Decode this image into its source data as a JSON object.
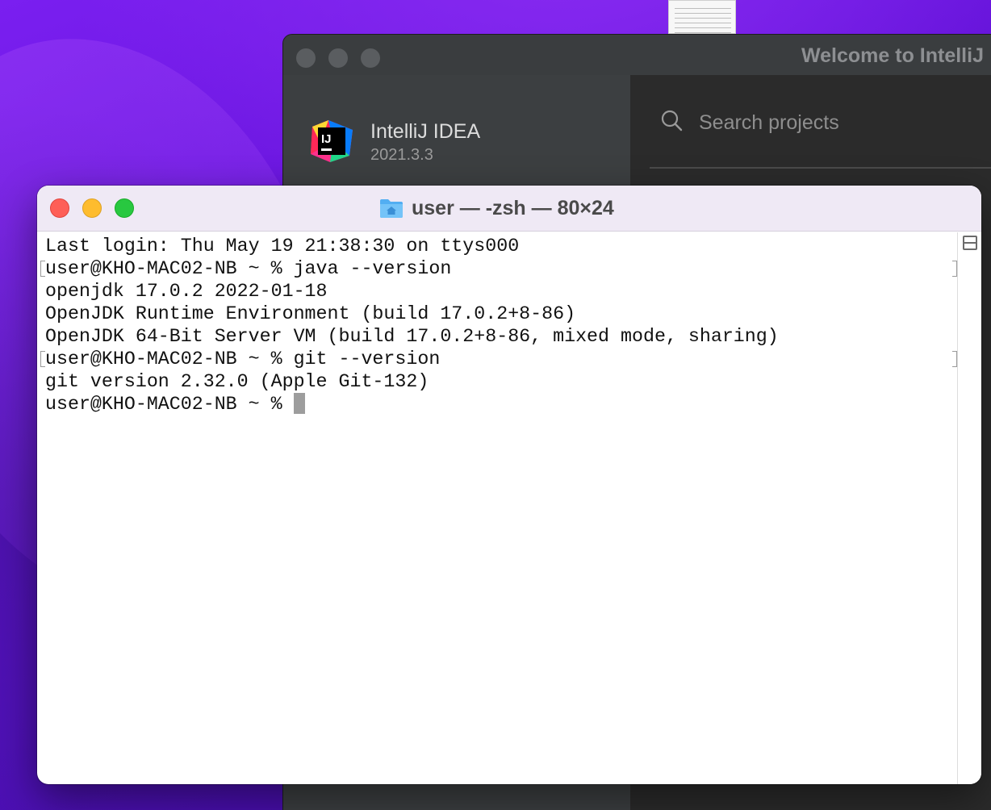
{
  "intellij": {
    "window_title": "Welcome to IntelliJ",
    "product_name": "IntelliJ IDEA",
    "version": "2021.3.3",
    "logo_text": "IJ",
    "search_placeholder": "Search projects"
  },
  "terminal": {
    "title": "user — -zsh — 80×24",
    "lines": [
      {
        "text": "Last login: Thu May 19 21:38:30 on ttys000",
        "marked": false
      },
      {
        "text": "user@KHO-MAC02-NB ~ % java --version",
        "marked": true
      },
      {
        "text": "openjdk 17.0.2 2022-01-18",
        "marked": false
      },
      {
        "text": "OpenJDK Runtime Environment (build 17.0.2+8-86)",
        "marked": false
      },
      {
        "text": "OpenJDK 64-Bit Server VM (build 17.0.2+8-86, mixed mode, sharing)",
        "marked": false
      },
      {
        "text": "user@KHO-MAC02-NB ~ % git --version",
        "marked": true
      },
      {
        "text": "git version 2.32.0 (Apple Git-132)",
        "marked": false
      }
    ],
    "prompt": "user@KHO-MAC02-NB ~ % "
  },
  "colors": {
    "close": "#fe5f57",
    "minimize": "#febc2e",
    "zoom": "#28c840",
    "wallpaper": "#6312d8"
  },
  "icons": {
    "folder": "home-folder-icon",
    "split": "split-pane-icon",
    "search": "search-icon"
  }
}
